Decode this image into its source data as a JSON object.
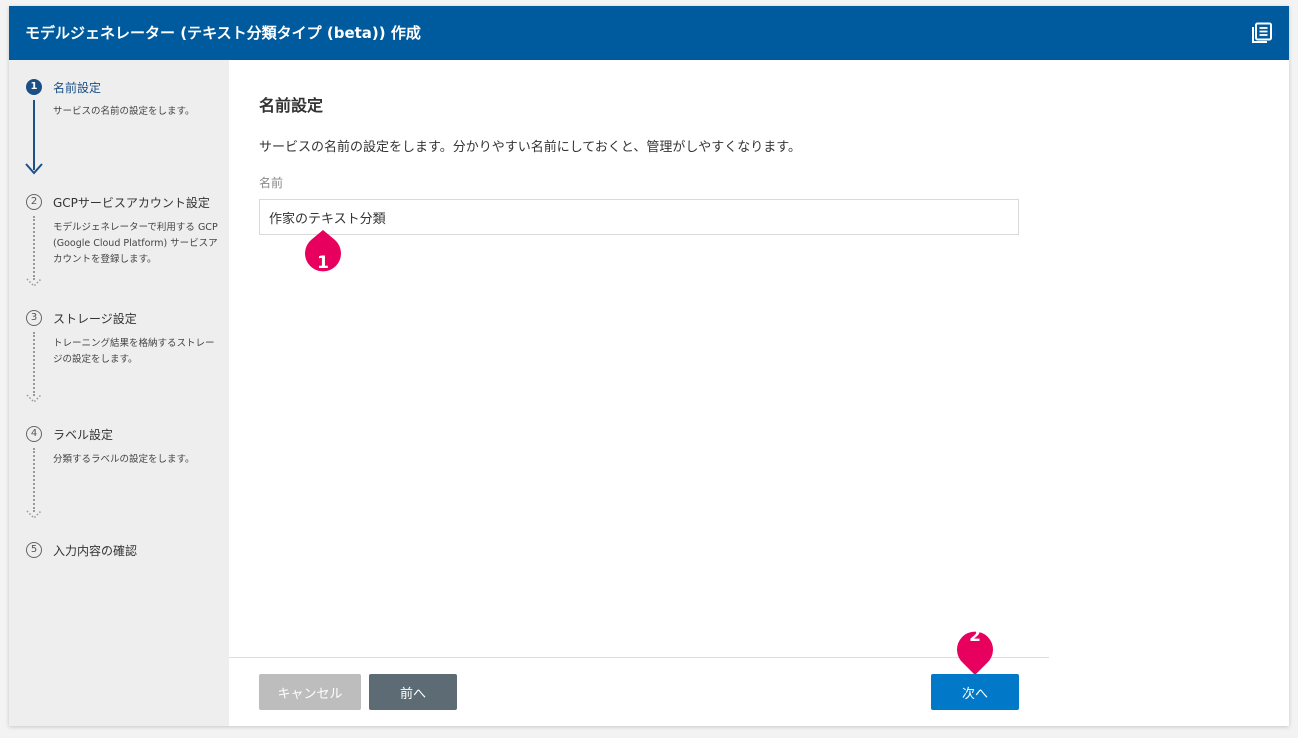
{
  "header": {
    "title": "モデルジェネレーター (テキスト分類タイプ (beta)) 作成"
  },
  "sidebar": {
    "steps": [
      {
        "number": "1",
        "title": "名前設定",
        "description": "サービスの名前の設定をします。"
      },
      {
        "number": "2",
        "title": "GCPサービスアカウント設定",
        "description": "モデルジェネレーターで利用する GCP (Google Cloud Platform) サービスアカウントを登録します。"
      },
      {
        "number": "3",
        "title": "ストレージ設定",
        "description": "トレーニング結果を格納するストレージの設定をします。"
      },
      {
        "number": "4",
        "title": "ラベル設定",
        "description": "分類するラベルの設定をします。"
      },
      {
        "number": "5",
        "title": "入力内容の確認",
        "description": ""
      }
    ]
  },
  "main": {
    "section_title": "名前設定",
    "section_description": "サービスの名前の設定をします。分かりやすい名前にしておくと、管理がしやすくなります。",
    "name_label": "名前",
    "name_value": "作家のテキスト分類"
  },
  "footer": {
    "cancel_label": "キャンセル",
    "prev_label": "前へ",
    "next_label": "次へ"
  },
  "annotations": {
    "marker_1": "1",
    "marker_2": "2",
    "color": "#e8005f"
  },
  "colors": {
    "header": "#005a9e",
    "active_step": "#1b4f86",
    "next_button": "#0278c8",
    "prev_button": "#5c6b74",
    "cancel_button": "#bdbdbd"
  }
}
